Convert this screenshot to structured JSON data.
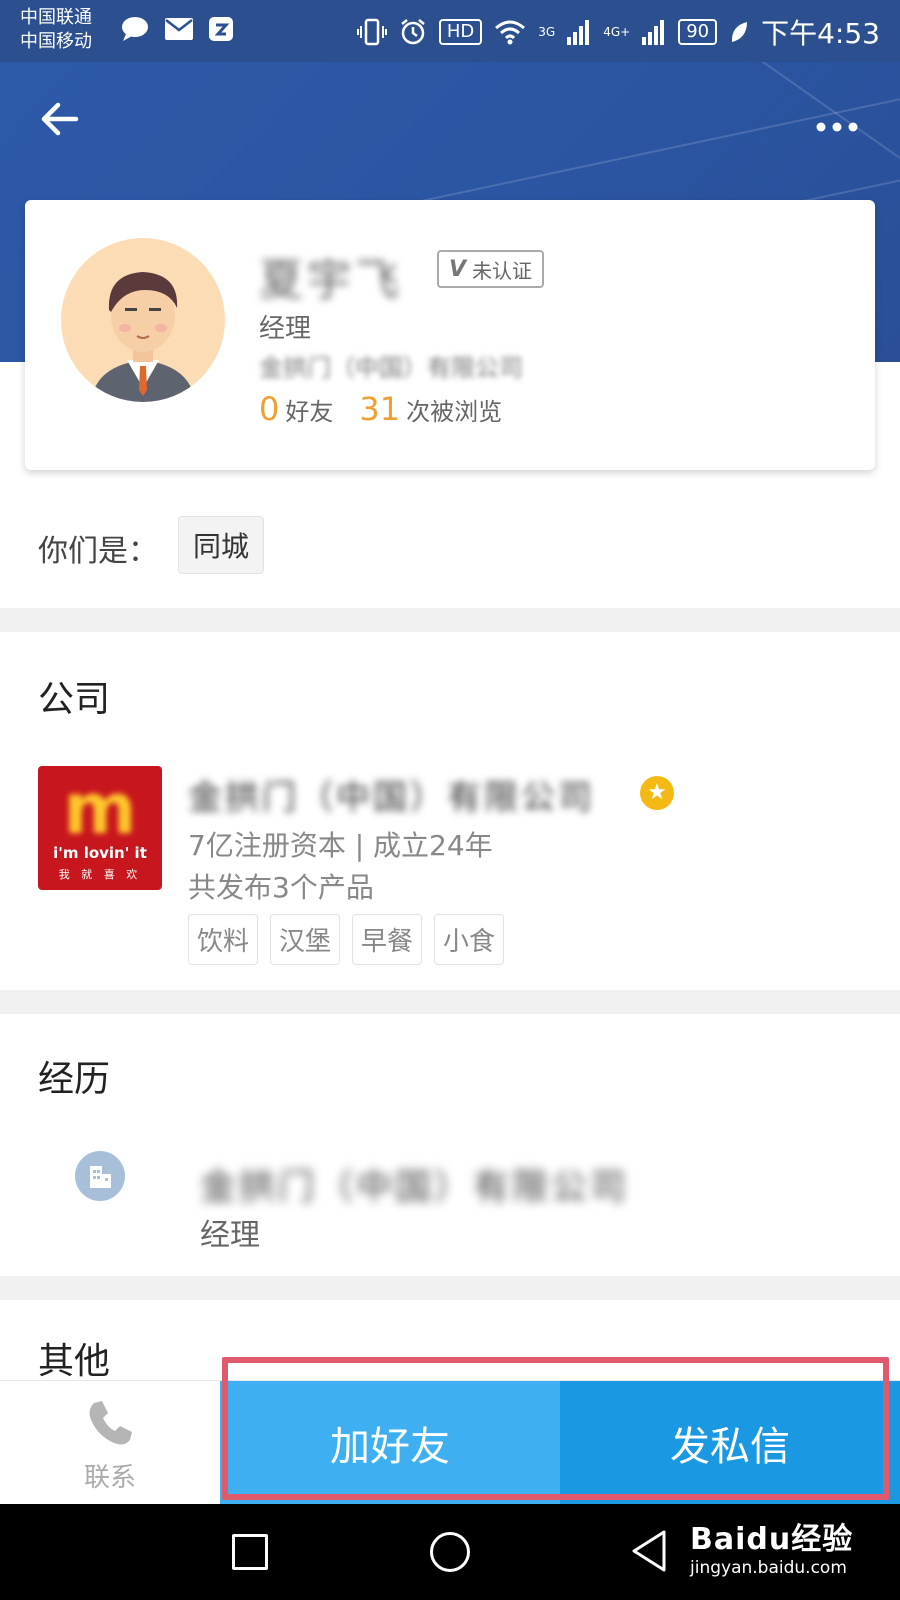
{
  "status_bar": {
    "carrier1": "中国联通",
    "carrier2": "中国移动",
    "battery": "90",
    "time": "下午4:53",
    "net1": "3G",
    "net2": "4G+",
    "hd": "HD"
  },
  "header": {
    "back_icon": "back-arrow-icon",
    "more_icon": "more-dots-icon"
  },
  "profile": {
    "name": "夏宇飞",
    "verify_mark": "V",
    "verify_label": "未认证",
    "title": "经理",
    "company": "金拱门（中国）有限公司",
    "friends_count": "0",
    "friends_label": "好友",
    "views_count": "31",
    "views_label": "次被浏览"
  },
  "relation": {
    "label": "你们是：",
    "tag": "同城"
  },
  "company_section": {
    "title": "公司",
    "logo_text": "i'm lovin' it",
    "logo_subtext": "我 就 喜 欢",
    "name": "金拱门（中国）有限公司",
    "info": "7亿注册资本 | 成立24年",
    "products": "共发布3个产品",
    "tags": [
      "饮料",
      "汉堡",
      "早餐",
      "小食"
    ]
  },
  "experience_section": {
    "title": "经历",
    "company": "金拱门（中国）有限公司",
    "role": "经理"
  },
  "other_section": {
    "title": "其他"
  },
  "bottom_bar": {
    "contact_label": "联系",
    "add_friend_label": "加好友",
    "message_label": "发私信"
  },
  "watermark": {
    "logo": "Baidu经验",
    "url": "jingyan.baidu.com"
  },
  "colors": {
    "header_blue": "#2c59a8",
    "accent_orange": "#f0a030",
    "add_button": "#3eb0f1",
    "message_button": "#1a98e2",
    "highlight_border": "#e05a6e"
  }
}
